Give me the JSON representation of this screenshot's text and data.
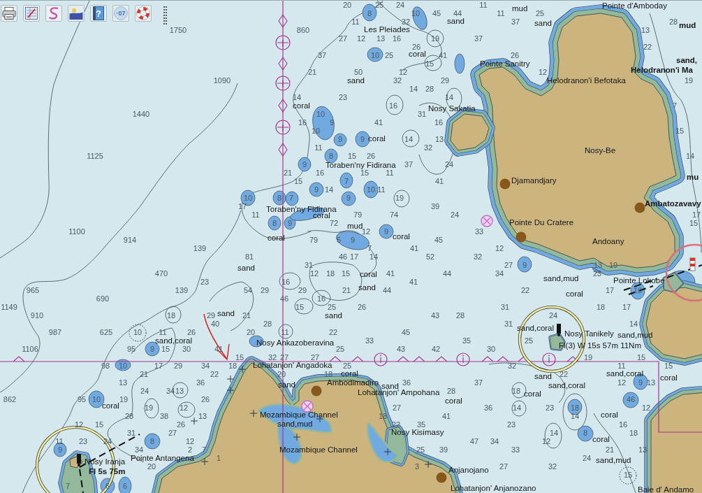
{
  "toolbar": {
    "buttons": [
      {
        "kind": "print"
      },
      {
        "kind": "edit"
      },
      {
        "kind": "route"
      },
      {
        "kind": "picture"
      },
      {
        "kind": "help",
        "text": "?"
      },
      {
        "kind": "depth",
        "text": "·07"
      },
      {
        "kind": "lifebuoy"
      }
    ]
  },
  "chart": {
    "place_names": [
      "Pointe d'Amboday",
      "Les Pleiades",
      "Pointe Sanitry",
      "Helodranon'i Befotaka",
      "Helodranon'i Ma",
      "Nosy Sakatia",
      "Nosy-Be",
      "Djamandjary",
      "Toraben'ny Fidirana",
      "Toraben'ny Fidirana",
      "Pointe Du Cratere",
      "Ambatozavavy",
      "Andoany",
      "Pointe Lokobe",
      "Nosy Ankazoberavina",
      "Lohatanjon' Angadoka",
      "Ambodimadiro",
      "Lohatanjon' Ampohana",
      "Mozambique Channel",
      "Mozambique Channel",
      "Nosy Kisimasy",
      "Nosy Iranja",
      "Pointe Antangena",
      "Anjanojano",
      "Lohatanjon' Anjanozano",
      "Nosy Tanikely",
      "Baie d' Andamo"
    ],
    "seabed_notes": [
      "mud",
      "sand",
      "sand",
      "mud",
      "sand,",
      "coral",
      "sand",
      "coral",
      "coral",
      "coral",
      "mud",
      "coral",
      "coral",
      "sand",
      "coral",
      "sand",
      "sand",
      "sand",
      "sand,coral",
      "coral",
      "mu",
      "sand,mud",
      "coral",
      "sand,coral",
      "sand,mud",
      "sand",
      "sand,coral",
      "sand,coral",
      "coral",
      "coral",
      "coral",
      "coral",
      "coral",
      "sand,mud",
      "coral",
      "sand",
      "sand",
      "sand,mud"
    ],
    "light_labels": [
      "Fl(3) W 15s 57m 11Nm",
      "Fl 5s 75m"
    ],
    "soundings": [
      "20",
      "25",
      "24",
      "11",
      "8",
      "10",
      "45",
      "44",
      "11",
      "25",
      "11",
      "32",
      "37",
      "28",
      "1750",
      "860",
      "13",
      "27",
      "12",
      "13",
      "16",
      "19",
      "37",
      "26",
      "22",
      "37",
      "10",
      "25",
      "41",
      "26",
      "15",
      "21",
      "50",
      "12",
      "12",
      "1090",
      "32",
      "29",
      "19",
      "14",
      "28",
      "14",
      "23",
      "14",
      "16",
      "7",
      "1440",
      "10",
      "31",
      "16",
      "9",
      "41",
      "16",
      "10",
      "15",
      "9",
      "9",
      "14",
      "13",
      "11",
      "32",
      "1125",
      "8",
      "15",
      "26",
      "14",
      "9",
      "37",
      "24",
      "21",
      "16",
      "15",
      "11",
      "15",
      "7",
      "41",
      "9",
      "14",
      "10",
      "11",
      "10",
      "8",
      "7",
      "9",
      "19",
      "17",
      "39",
      "11",
      "79",
      "74",
      "24",
      "17",
      "8",
      "9",
      "72",
      "15",
      "1100",
      "12",
      "9",
      "33",
      "914",
      "79",
      "5",
      "9",
      "45",
      "139",
      "7",
      "41",
      "12",
      "81",
      "46",
      "17",
      "14",
      "52",
      "32",
      "31",
      "27",
      "9",
      "13",
      "19",
      "470",
      "12",
      "18",
      "15",
      "41",
      "44",
      "34",
      "23",
      "23",
      "16",
      "41",
      "965",
      "139",
      "54",
      "29",
      "29",
      "21",
      "44",
      "22",
      "17",
      "10",
      "690",
      "46",
      "16",
      "1149",
      "15",
      "25",
      "26",
      "31",
      "18",
      "17",
      "910",
      "18",
      "29",
      "21",
      "43",
      "28",
      "24",
      "40",
      "28",
      "31",
      "14",
      "987",
      "625",
      "10",
      "11",
      "26",
      "20",
      "11",
      "22",
      "45",
      "33",
      "35",
      "25",
      "1106",
      "95",
      "9",
      "15",
      "30",
      "41",
      "25",
      "43",
      "42",
      "30",
      "15",
      "32",
      "27",
      "27",
      "19",
      "15",
      "98",
      "10",
      "17",
      "29",
      "34",
      "18",
      "25",
      "32",
      "11",
      "15",
      "21",
      "22",
      "20",
      "18",
      "22",
      "13",
      "36",
      "36",
      "37",
      "12",
      "9",
      "13",
      "24",
      "34",
      "13",
      "28",
      "18",
      "862",
      "95",
      "10",
      "19",
      "26",
      "46",
      "19",
      "12",
      "27",
      "36",
      "14",
      "23",
      "18",
      "12",
      "28",
      "38",
      "13",
      "18",
      "41",
      "14",
      "12",
      "15",
      "26",
      "22",
      "35",
      "23",
      "16",
      "31",
      "27",
      "14",
      "8",
      "18",
      "11",
      "23",
      "24",
      "8",
      "12",
      "47",
      "34",
      "12",
      "9",
      "34",
      "2",
      "7",
      "25",
      "39",
      "33",
      "21",
      "13",
      "1",
      "24",
      "20",
      "3",
      "27",
      "32",
      "15",
      "7",
      "6",
      "6"
    ]
  }
}
